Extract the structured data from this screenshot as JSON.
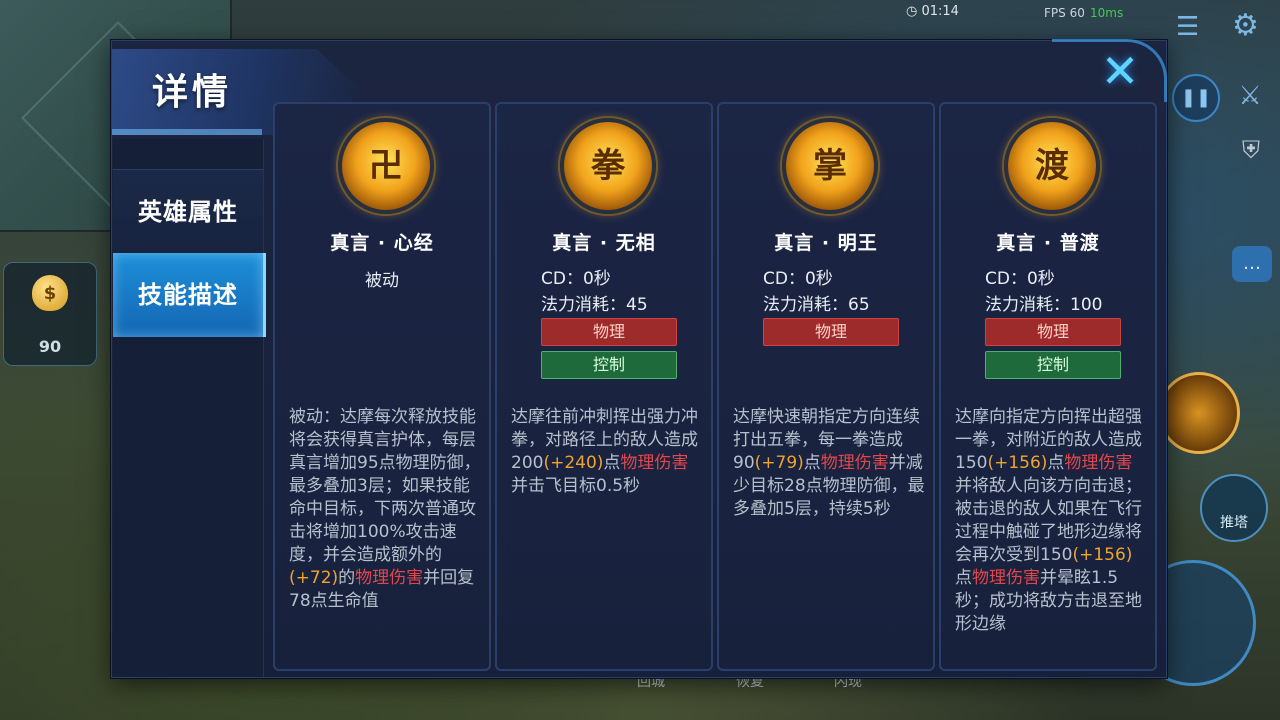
{
  "hud": {
    "clock": "01:14",
    "fps": "FPS 60",
    "ping": "10ms",
    "gold": "90",
    "gold_symbol": "$",
    "tower_label": "推塔",
    "bottom": [
      "回城",
      "恢复",
      "闪现"
    ]
  },
  "dialog": {
    "title": "详情",
    "close_symbol": "✕"
  },
  "sidebar": {
    "tabs": [
      {
        "label": "英雄属性"
      },
      {
        "label": "技能描述"
      }
    ]
  },
  "skills": [
    {
      "name": "真言 · 心经",
      "icon": "卍",
      "type": "被动",
      "desc": [
        {
          "t": "被动：达摩每次释放技能将会获得真言护体，每层真言增加95点物理防御，最多叠加3层；如果技能命中目标，下两次普通攻击将增加100%攻击速度，并会造成额外的"
        },
        {
          "t": "(+72)",
          "c": "o"
        },
        {
          "t": "的"
        },
        {
          "t": "物理伤害",
          "c": "r"
        },
        {
          "t": "并回复78点生命值"
        }
      ]
    },
    {
      "name": "真言 · 无相",
      "icon": "拳",
      "cd": "CD：0秒",
      "mana": "法力消耗：45",
      "tags": [
        "物理",
        "控制"
      ],
      "desc": [
        {
          "t": "达摩往前冲刺挥出强力冲拳，对路径上的敌人造成200"
        },
        {
          "t": "(+240)",
          "c": "o"
        },
        {
          "t": "点"
        },
        {
          "t": "物理伤害",
          "c": "r"
        },
        {
          "t": "并击飞目标0.5秒"
        }
      ]
    },
    {
      "name": "真言 · 明王",
      "icon": "掌",
      "cd": "CD：0秒",
      "mana": "法力消耗：65",
      "tags": [
        "物理"
      ],
      "desc": [
        {
          "t": "达摩快速朝指定方向连续打出五拳，每一拳造成90"
        },
        {
          "t": "(+79)",
          "c": "o"
        },
        {
          "t": "点"
        },
        {
          "t": "物理伤害",
          "c": "r"
        },
        {
          "t": "并减少目标28点物理防御，最多叠加5层，持续5秒"
        }
      ]
    },
    {
      "name": "真言 · 普渡",
      "icon": "渡",
      "cd": "CD：0秒",
      "mana": "法力消耗：100",
      "tags": [
        "物理",
        "控制"
      ],
      "desc": [
        {
          "t": "达摩向指定方向挥出超强一拳，对附近的敌人造成150"
        },
        {
          "t": "(+156)",
          "c": "o"
        },
        {
          "t": "点"
        },
        {
          "t": "物理伤害",
          "c": "r"
        },
        {
          "t": "并将敌人向该方向击退；被击退的敌人如果在飞行过程中触碰了地形边缘将会再次受到150"
        },
        {
          "t": "(+156)",
          "c": "o"
        },
        {
          "t": "点"
        },
        {
          "t": "物理伤害",
          "c": "r"
        },
        {
          "t": "并晕眩1.5秒；成功将敌方击退至地形边缘"
        }
      ]
    }
  ]
}
